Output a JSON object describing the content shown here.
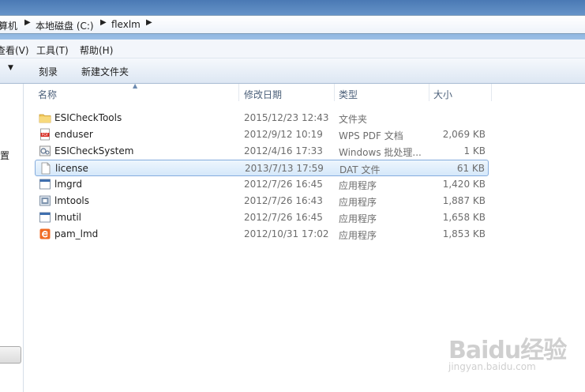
{
  "address": {
    "crumbs": [
      "算机",
      "本地磁盘 (C:)",
      "flexlm"
    ]
  },
  "menu": {
    "view": "查看(V)",
    "tools": "工具(T)",
    "help": "帮助(H)"
  },
  "toolbar": {
    "burn": "刻录",
    "new_folder": "新建文件夹"
  },
  "nav": {
    "partial_glyph": "置"
  },
  "columns": {
    "name": "名称",
    "date": "修改日期",
    "type": "类型",
    "size": "大小"
  },
  "files": [
    {
      "name": "ESICheckTools",
      "date": "2015/12/23 12:43",
      "type": "文件夹",
      "size": "",
      "icon": "folder-icon"
    },
    {
      "name": "enduser",
      "date": "2012/9/12 10:19",
      "type": "WPS PDF 文档",
      "size": "2,069 KB",
      "icon": "pdf-icon"
    },
    {
      "name": "ESICheckSystem",
      "date": "2012/4/16 17:33",
      "type": "Windows 批处理...",
      "size": "1 KB",
      "icon": "batch-file-icon"
    },
    {
      "name": "license",
      "date": "2013/7/13 17:59",
      "type": "DAT 文件",
      "size": "61 KB",
      "icon": "document-icon"
    },
    {
      "name": "lmgrd",
      "date": "2012/7/26 16:45",
      "type": "应用程序",
      "size": "1,420 KB",
      "icon": "application-icon"
    },
    {
      "name": "lmtools",
      "date": "2012/7/26 16:43",
      "type": "应用程序",
      "size": "1,887 KB",
      "icon": "lmtools-icon"
    },
    {
      "name": "lmutil",
      "date": "2012/7/26 16:45",
      "type": "应用程序",
      "size": "1,658 KB",
      "icon": "application-icon"
    },
    {
      "name": "pam_lmd",
      "date": "2012/10/31 17:02",
      "type": "应用程序",
      "size": "1,853 KB",
      "icon": "pam-app-icon"
    }
  ],
  "selected_file": "license",
  "watermark": {
    "brand": "Baidu经验",
    "url": "jingyan.baidu.com"
  }
}
